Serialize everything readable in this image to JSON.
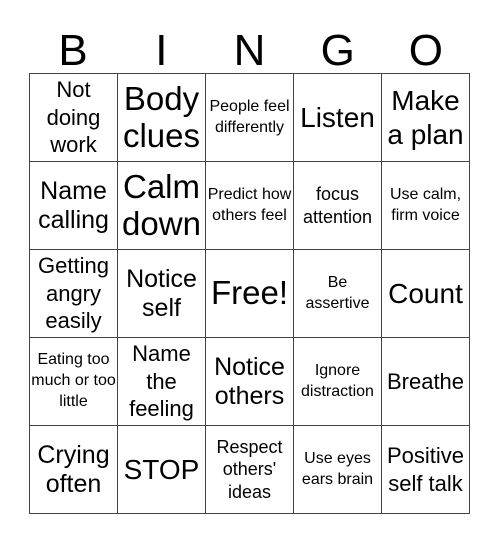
{
  "header": [
    "B",
    "I",
    "N",
    "G",
    "O"
  ],
  "cells": [
    [
      "Not doing work",
      "Body clues",
      "People feel differently",
      "Listen",
      "Make a plan"
    ],
    [
      "Name calling",
      "Calm down",
      "Predict how others feel",
      "focus attention",
      "Use calm, firm voice"
    ],
    [
      "Getting angry easily",
      "Notice self",
      "Free!",
      "Be assertive",
      "Count"
    ],
    [
      "Eating too much or too little",
      "Name the feeling",
      "Notice others",
      "Ignore distraction",
      "Breathe"
    ],
    [
      "Crying often",
      "STOP",
      "Respect others' ideas",
      "Use eyes ears brain",
      "Positive self talk"
    ]
  ]
}
